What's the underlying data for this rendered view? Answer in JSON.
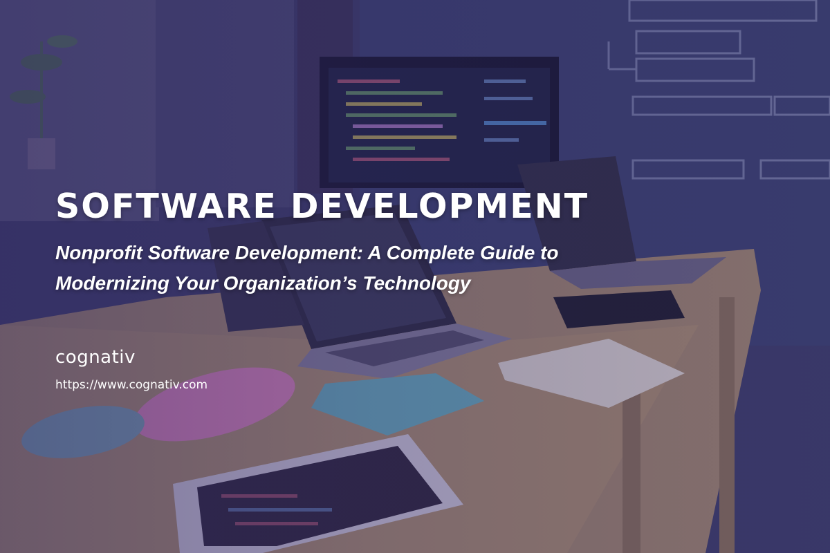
{
  "banner": {
    "category": "SOFTWARE DEVELOPMENT",
    "title_line1": "Nonprofit Software Development: A Complete Guide to",
    "title_line2": "Modernizing Your Organization’s Technology",
    "brand_name": "cognativ",
    "url": "https://www.cognativ.com"
  },
  "colors": {
    "overlay": "#302662",
    "text": "#ffffff",
    "accent_pink": "#e58bc0",
    "accent_teal": "#6bb8c4"
  },
  "icons": [
    "laptop-icon",
    "tablet-icon",
    "notebook-icon",
    "pencil-case-icon",
    "plant-icon"
  ]
}
